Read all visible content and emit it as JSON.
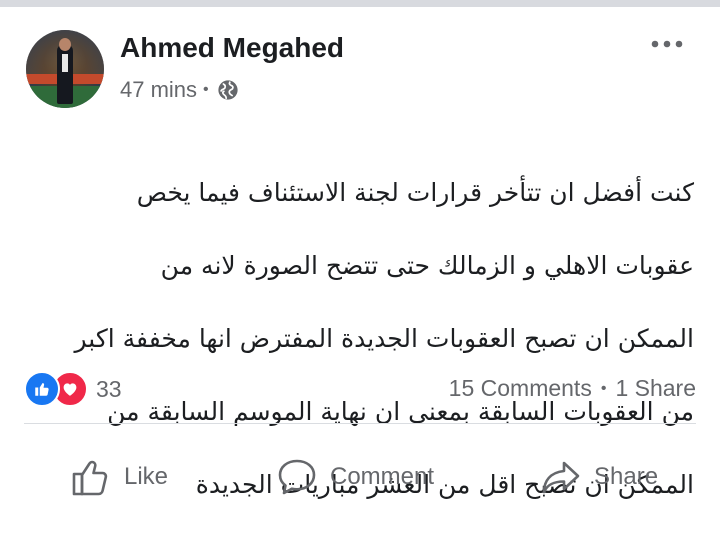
{
  "post": {
    "author": "Ahmed Megahed",
    "time": "47 mins",
    "meta_separator": "•",
    "privacy_icon": "globe-icon",
    "more_icon": "more-horizontal-icon",
    "text_lines": [
      "كنت أفضل ان تتأخر قرارات لجنة الاستئناف فيما يخص",
      "عقوبات الاهلي و الزمالك حتى تتضح الصورة لانه من",
      "الممكن ان تصبح العقوبات الجديدة المفترض انها مخففة اكبر",
      "من العقوبات السابقة بمعنى ان نهاية الموسم السابقة من",
      "الممكن ان تصبح اقل من العشر مباريات  الجديدة"
    ]
  },
  "reactions": {
    "icons": [
      "like-reaction-icon",
      "love-reaction-icon"
    ],
    "count": "33",
    "colors": {
      "like": "#1877f2",
      "love": "#f02849"
    }
  },
  "stats": {
    "comments": "15 Comments",
    "separator": "•",
    "shares": "1 Share"
  },
  "actions": {
    "like_label": "Like",
    "comment_label": "Comment",
    "share_label": "Share"
  }
}
